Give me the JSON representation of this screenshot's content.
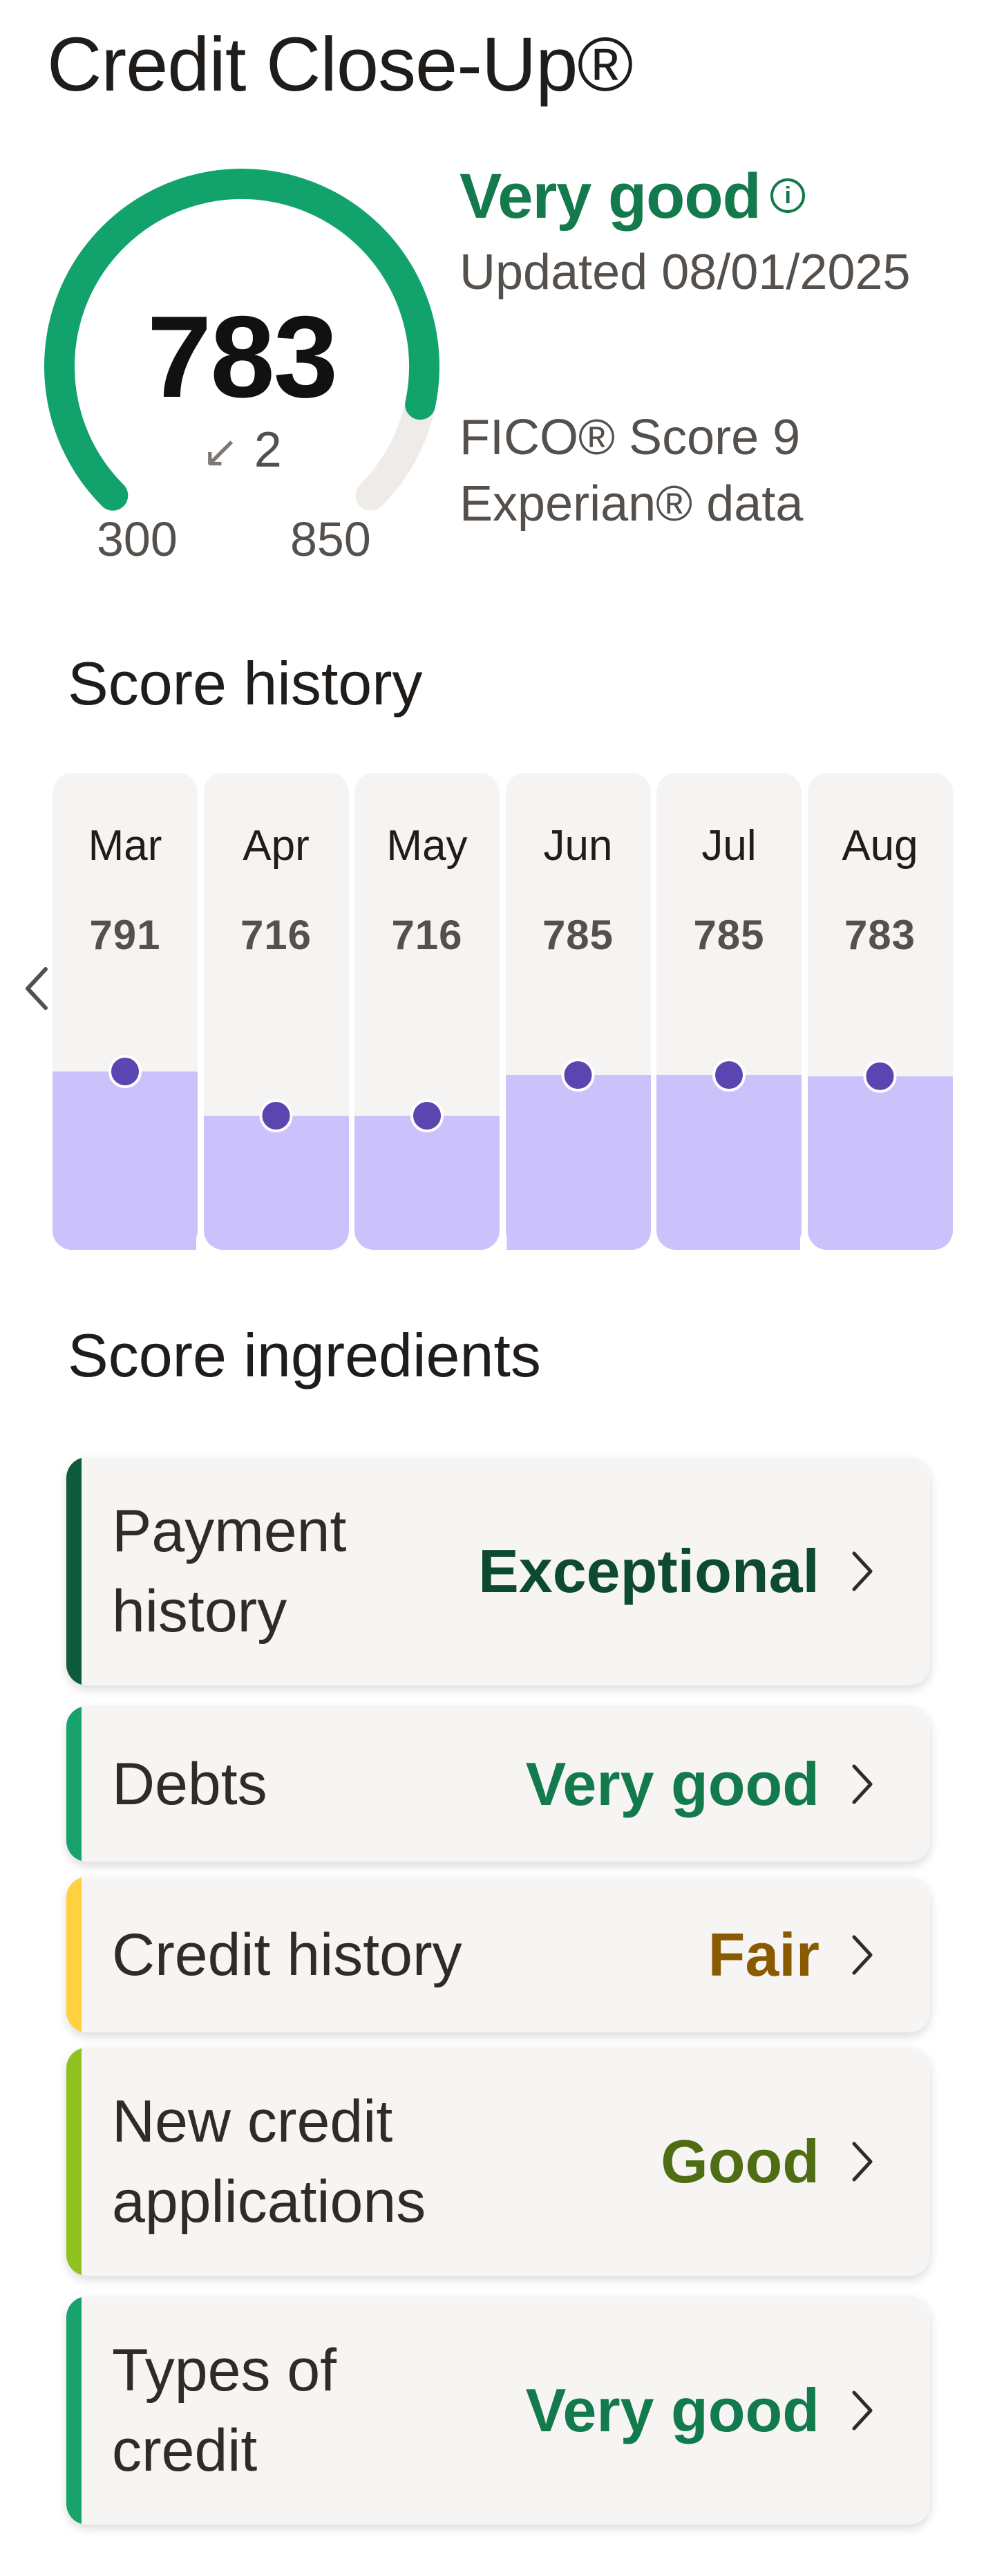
{
  "title": "Credit Close-Up®",
  "score": {
    "value": "783",
    "change": "2",
    "change_direction": "down",
    "min": "300",
    "max": "850",
    "fraction": 0.878,
    "rating": "Very good",
    "updated": "Updated 08/01/2025",
    "model_line1": "FICO® Score 9",
    "model_line2": "Experian® data"
  },
  "history": {
    "title": "Score history",
    "months": [
      {
        "label": "Mar",
        "score": "791"
      },
      {
        "label": "Apr",
        "score": "716"
      },
      {
        "label": "May",
        "score": "716"
      },
      {
        "label": "Jun",
        "score": "785"
      },
      {
        "label": "Jul",
        "score": "785"
      },
      {
        "label": "Aug",
        "score": "783"
      }
    ]
  },
  "ingredients": {
    "title": "Score ingredients",
    "items": [
      {
        "label": "Payment history",
        "rating": "Exceptional",
        "accent": "#0e5c3c",
        "rating_color": "#0d4a30"
      },
      {
        "label": "Debts",
        "rating": "Very good",
        "accent": "#17a36b",
        "rating_color": "#127a4c"
      },
      {
        "label": "Credit history",
        "rating": "Fair",
        "accent": "#ffd13f",
        "rating_color": "#8a5a00"
      },
      {
        "label": "New credit applications",
        "rating": "Good",
        "accent": "#8ec21f",
        "rating_color": "#4f6d12"
      },
      {
        "label": "Types of credit",
        "rating": "Very good",
        "accent": "#17a36b",
        "rating_color": "#127a4c"
      }
    ]
  },
  "colors": {
    "gauge_fill": "#12a36c",
    "gauge_track": "#eeebe9",
    "history_fill": "#cbc2fb",
    "history_dot": "#5b45b0"
  },
  "icons": {
    "info": "info-icon",
    "score_change": "arrow-down-left-icon",
    "previous": "chevron-left-icon",
    "row": "chevron-right-icon"
  }
}
